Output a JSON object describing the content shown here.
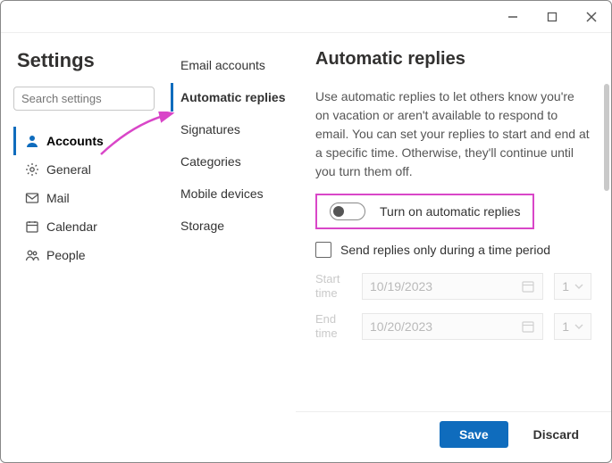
{
  "window": {
    "title": "Settings"
  },
  "search": {
    "placeholder": "Search settings"
  },
  "nav1": {
    "items": [
      {
        "label": "Accounts",
        "active": true
      },
      {
        "label": "General",
        "active": false
      },
      {
        "label": "Mail",
        "active": false
      },
      {
        "label": "Calendar",
        "active": false
      },
      {
        "label": "People",
        "active": false
      }
    ]
  },
  "nav2": {
    "items": [
      {
        "label": "Email accounts",
        "active": false
      },
      {
        "label": "Automatic replies",
        "active": true
      },
      {
        "label": "Signatures",
        "active": false
      },
      {
        "label": "Categories",
        "active": false
      },
      {
        "label": "Mobile devices",
        "active": false
      },
      {
        "label": "Storage",
        "active": false
      }
    ]
  },
  "main": {
    "heading": "Automatic replies",
    "description": "Use automatic replies to let others know you're on vacation or aren't available to respond to email. You can set your replies to start and end at a specific time. Otherwise, they'll continue until you turn them off.",
    "toggle_label": "Turn on automatic replies",
    "toggle_on": false,
    "checkbox_label": "Send replies only during a time period",
    "checkbox_checked": false,
    "start_label": "Start time",
    "start_date": "10/19/2023",
    "start_hour": "1",
    "end_label": "End time",
    "end_date": "10/20/2023",
    "end_hour": "1"
  },
  "footer": {
    "save": "Save",
    "discard": "Discard"
  }
}
